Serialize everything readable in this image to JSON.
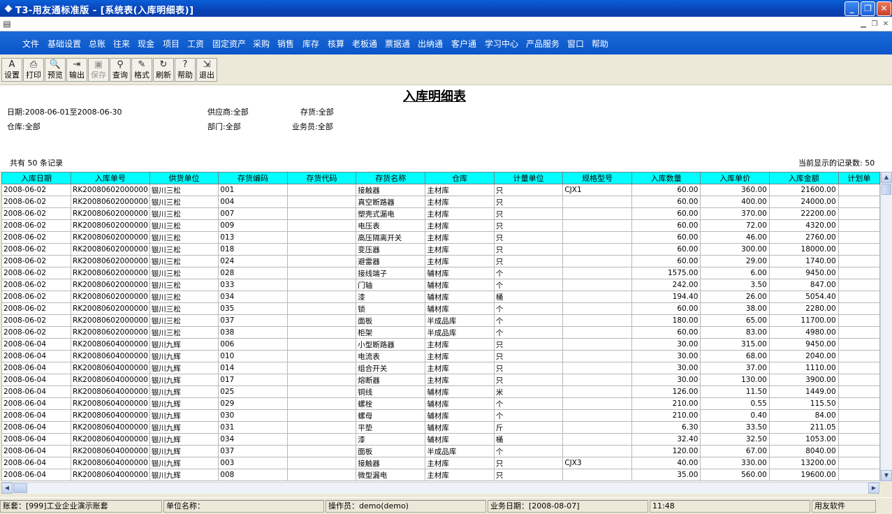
{
  "window": {
    "title": "T3-用友通标准版 - [系统表(入库明细表)]",
    "icon": "app-icon",
    "minimize": "_",
    "restore": "❐",
    "close": "✕"
  },
  "menu": [
    "文件",
    "基础设置",
    "总账",
    "往来",
    "现金",
    "项目",
    "工资",
    "固定资产",
    "采购",
    "销售",
    "库存",
    "核算",
    "老板通",
    "票据通",
    "出纳通",
    "客户通",
    "学习中心",
    "产品服务",
    "窗口",
    "帮助"
  ],
  "toolbar": [
    {
      "label": "设置",
      "icon": "setup-icon",
      "glyph": "A",
      "enabled": true
    },
    {
      "label": "打印",
      "icon": "printer-icon",
      "glyph": "⎙",
      "enabled": true
    },
    {
      "label": "预览",
      "icon": "preview-icon",
      "glyph": "🔍",
      "enabled": true
    },
    {
      "label": "输出",
      "icon": "export-icon",
      "glyph": "⇥",
      "enabled": true
    },
    {
      "label": "保存",
      "icon": "save-icon",
      "glyph": "▣",
      "enabled": false
    },
    {
      "label": "查询",
      "icon": "binoculars-icon",
      "glyph": "⚲",
      "enabled": true
    },
    {
      "label": "格式",
      "icon": "format-icon",
      "glyph": "✎",
      "enabled": true
    },
    {
      "label": "刷新",
      "icon": "refresh-icon",
      "glyph": "↻",
      "enabled": true
    },
    {
      "label": "帮助",
      "icon": "help-icon",
      "glyph": "?",
      "enabled": true
    },
    {
      "label": "退出",
      "icon": "exit-icon",
      "glyph": "⇲",
      "enabled": true
    }
  ],
  "report": {
    "title": "入库明细表",
    "date_range": "日期:2008-06-01至2008-06-30",
    "supplier": "供应商:全部",
    "inventory": "存货:全部",
    "warehouse": "仓库:全部",
    "department": "部门:全部",
    "salesperson": "业务员:全部",
    "record_count": "共有 50 条记录",
    "displayed_count": "当前显示的记录数: 50"
  },
  "table": {
    "columns": [
      "入库日期",
      "入库单号",
      "供货单位",
      "存货编码",
      "存货代码",
      "存货名称",
      "仓库",
      "计量单位",
      "规格型号",
      "入库数量",
      "入库单价",
      "入库金额",
      "计划单"
    ],
    "rows": [
      [
        "2008-06-02",
        "RK20080602000000",
        "银川三松",
        "001",
        "",
        "接触器",
        "主材库",
        "只",
        "CJX1",
        "60.00",
        "360.00",
        "21600.00"
      ],
      [
        "2008-06-02",
        "RK20080602000000",
        "银川三松",
        "004",
        "",
        "真空断路器",
        "主材库",
        "只",
        "",
        "60.00",
        "400.00",
        "24000.00"
      ],
      [
        "2008-06-02",
        "RK20080602000000",
        "银川三松",
        "007",
        "",
        "塑壳式漏电",
        "主材库",
        "只",
        "",
        "60.00",
        "370.00",
        "22200.00"
      ],
      [
        "2008-06-02",
        "RK20080602000000",
        "银川三松",
        "009",
        "",
        "电压表",
        "主材库",
        "只",
        "",
        "60.00",
        "72.00",
        "4320.00"
      ],
      [
        "2008-06-02",
        "RK20080602000000",
        "银川三松",
        "013",
        "",
        "高压隔离开关",
        "主材库",
        "只",
        "",
        "60.00",
        "46.00",
        "2760.00"
      ],
      [
        "2008-06-02",
        "RK20080602000000",
        "银川三松",
        "018",
        "",
        "变压器",
        "主材库",
        "只",
        "",
        "60.00",
        "300.00",
        "18000.00"
      ],
      [
        "2008-06-02",
        "RK20080602000000",
        "银川三松",
        "024",
        "",
        "避雷器",
        "主材库",
        "只",
        "",
        "60.00",
        "29.00",
        "1740.00"
      ],
      [
        "2008-06-02",
        "RK20080602000000",
        "银川三松",
        "028",
        "",
        "接线端子",
        "辅材库",
        "个",
        "",
        "1575.00",
        "6.00",
        "9450.00"
      ],
      [
        "2008-06-02",
        "RK20080602000000",
        "银川三松",
        "033",
        "",
        "门轴",
        "辅材库",
        "个",
        "",
        "242.00",
        "3.50",
        "847.00"
      ],
      [
        "2008-06-02",
        "RK20080602000000",
        "银川三松",
        "034",
        "",
        "漆",
        "辅材库",
        "桶",
        "",
        "194.40",
        "26.00",
        "5054.40"
      ],
      [
        "2008-06-02",
        "RK20080602000000",
        "银川三松",
        "035",
        "",
        "锁",
        "辅材库",
        "个",
        "",
        "60.00",
        "38.00",
        "2280.00"
      ],
      [
        "2008-06-02",
        "RK20080602000000",
        "银川三松",
        "037",
        "",
        "面板",
        "半成品库",
        "个",
        "",
        "180.00",
        "65.00",
        "11700.00"
      ],
      [
        "2008-06-02",
        "RK20080602000000",
        "银川三松",
        "038",
        "",
        "柜架",
        "半成品库",
        "个",
        "",
        "60.00",
        "83.00",
        "4980.00"
      ],
      [
        "2008-06-04",
        "RK20080604000000",
        "银川九辉",
        "006",
        "",
        "小型断路器",
        "主材库",
        "只",
        "",
        "30.00",
        "315.00",
        "9450.00"
      ],
      [
        "2008-06-04",
        "RK20080604000000",
        "银川九辉",
        "010",
        "",
        "电流表",
        "主材库",
        "只",
        "",
        "30.00",
        "68.00",
        "2040.00"
      ],
      [
        "2008-06-04",
        "RK20080604000000",
        "银川九辉",
        "014",
        "",
        "组合开关",
        "主材库",
        "只",
        "",
        "30.00",
        "37.00",
        "1110.00"
      ],
      [
        "2008-06-04",
        "RK20080604000000",
        "银川九辉",
        "017",
        "",
        "熔断器",
        "主材库",
        "只",
        "",
        "30.00",
        "130.00",
        "3900.00"
      ],
      [
        "2008-06-04",
        "RK20080604000000",
        "银川九辉",
        "025",
        "",
        "铜线",
        "辅材库",
        "米",
        "",
        "126.00",
        "11.50",
        "1449.00"
      ],
      [
        "2008-06-04",
        "RK20080604000000",
        "银川九辉",
        "029",
        "",
        "螺栓",
        "辅材库",
        "个",
        "",
        "210.00",
        "0.55",
        "115.50"
      ],
      [
        "2008-06-04",
        "RK20080604000000",
        "银川九辉",
        "030",
        "",
        "螺母",
        "辅材库",
        "个",
        "",
        "210.00",
        "0.40",
        "84.00"
      ],
      [
        "2008-06-04",
        "RK20080604000000",
        "银川九辉",
        "031",
        "",
        "平垫",
        "辅材库",
        "斤",
        "",
        "6.30",
        "33.50",
        "211.05"
      ],
      [
        "2008-06-04",
        "RK20080604000000",
        "银川九辉",
        "034",
        "",
        "漆",
        "辅材库",
        "桶",
        "",
        "32.40",
        "32.50",
        "1053.00"
      ],
      [
        "2008-06-04",
        "RK20080604000000",
        "银川九辉",
        "037",
        "",
        "面板",
        "半成品库",
        "个",
        "",
        "120.00",
        "67.00",
        "8040.00"
      ],
      [
        "2008-06-04",
        "RK20080604000000",
        "银川九辉",
        "003",
        "",
        "接触器",
        "主材库",
        "只",
        "CJX3",
        "40.00",
        "330.00",
        "13200.00"
      ],
      [
        "2008-06-04",
        "RK20080604000000",
        "银川九辉",
        "008",
        "",
        "微型漏电",
        "主材库",
        "只",
        "",
        "35.00",
        "560.00",
        "19600.00"
      ]
    ]
  },
  "status": {
    "account": "账套：[999]工业企业演示账套",
    "unit": "单位名称：",
    "operator": "操作员：demo(demo)",
    "business_date": "业务日期：[2008-08-07]",
    "time": "11:48",
    "vendor": "用友软件"
  },
  "colors": {
    "header_bg": "#00ffff",
    "menubar_bg": "#0b55c8",
    "titlebar_bg": "#0842b8"
  }
}
